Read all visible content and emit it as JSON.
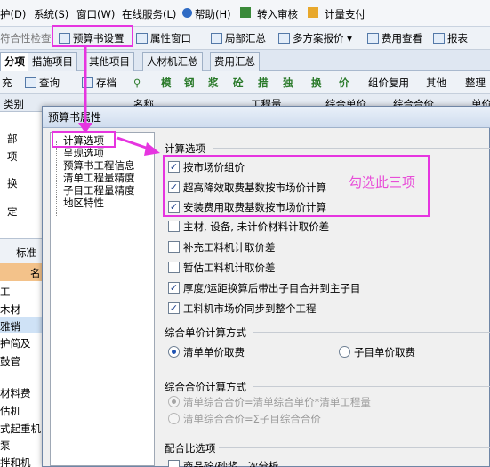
{
  "menubar": {
    "items": [
      "护(D)",
      "系统(S)",
      "窗口(W)",
      "在线服务(L)",
      "帮助(H)",
      "转入审核",
      "计量支付"
    ]
  },
  "toolbar2": {
    "items": [
      "符合性检查",
      "预算书设置",
      "属性窗口",
      "局部汇总",
      "多方案报价",
      "费用查看",
      "报表"
    ]
  },
  "tabs": [
    "分项",
    "措施项目",
    "其他项目",
    "人材机汇总",
    "费用汇总"
  ],
  "toolbar3": {
    "items": [
      "充",
      "查询",
      "存档",
      "模",
      "钢",
      "浆",
      "砼",
      "措",
      "独",
      "换",
      "价",
      "组价复用",
      "其他",
      "整理"
    ],
    "arrow": "▼"
  },
  "grid_header": {
    "cols": [
      "类别",
      "名称",
      "工程量",
      "综合单价",
      "综合合价",
      "单价"
    ]
  },
  "left_pane": {
    "rows": [
      "部",
      "项",
      "换",
      "定"
    ],
    "label": "标准",
    "col": "名",
    "items": [
      "工",
      "木材",
      "雅销",
      "护简及",
      "鼓管",
      "材料费",
      "估机",
      "式起重机",
      "泵",
      "拌和机",
      "机"
    ]
  },
  "dialog": {
    "title": "预算书属性",
    "tree": [
      "计算选项",
      "呈现选项",
      "预算书工程信息",
      "清单工程量精度",
      "子目工程量精度",
      "地区特性"
    ],
    "section1": "计算选项",
    "options": [
      {
        "label": "按市场价组价",
        "checked": true
      },
      {
        "label": "超高降效取费基数按市场价计算",
        "checked": true
      },
      {
        "label": "安装费用取费基数按市场价计算",
        "checked": true
      },
      {
        "label": "主材, 设备, 未计价材料计取价差",
        "checked": false
      },
      {
        "label": "补充工料机计取价差",
        "checked": false
      },
      {
        "label": "暂估工料机计取价差",
        "checked": false
      },
      {
        "label": "厚度/运距换算后带出子目合并到主子目",
        "checked": true
      },
      {
        "label": "工料机市场价同步到整个工程",
        "checked": true
      }
    ],
    "section2": "综合单价计算方式",
    "unit_price": [
      {
        "label": "清单单价取费",
        "selected": true
      },
      {
        "label": "子目单价取费",
        "selected": false
      }
    ],
    "section3": "综合合价计算方式",
    "total_price": [
      {
        "label": "清单综合合价=清单综合单价*清单工程量",
        "selected": true
      },
      {
        "label": "清单综合合价=Σ子目综合合价",
        "selected": false
      }
    ],
    "section4": "配合比选项",
    "mix_option": {
      "label": "商品砼/砂浆二次分析",
      "checked": false
    }
  },
  "annotation": {
    "text": "勾选此三项",
    "color": "#e84dd8"
  }
}
